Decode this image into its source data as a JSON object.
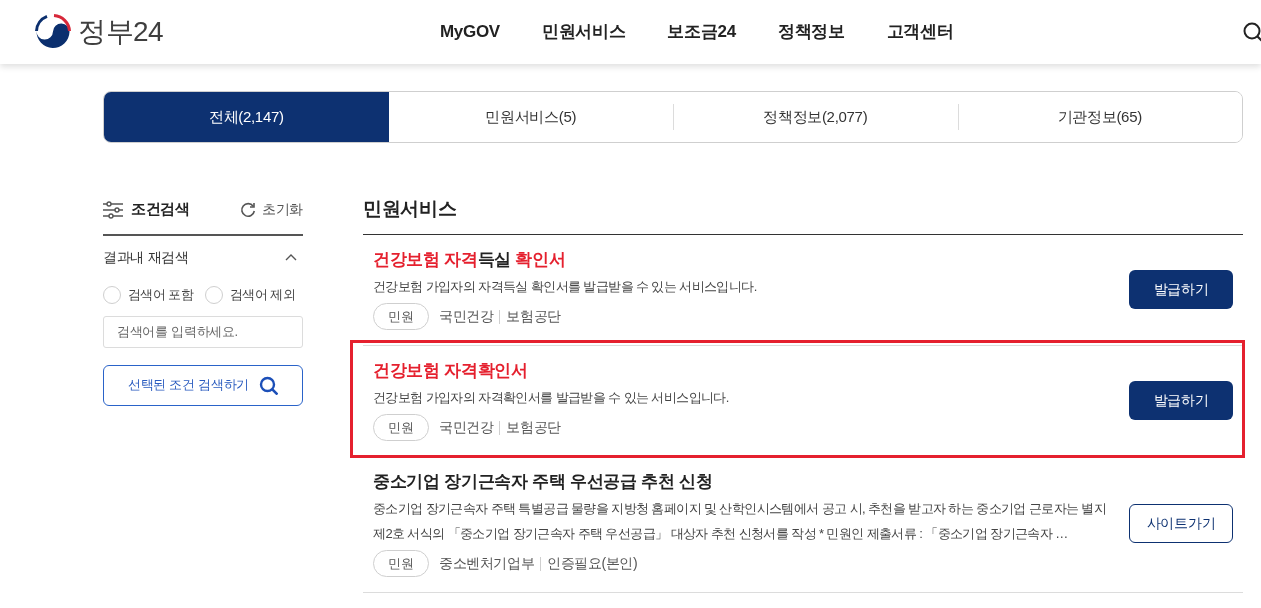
{
  "header": {
    "logo_text": "정부24",
    "nav": [
      "MyGOV",
      "민원서비스",
      "보조금24",
      "정책정보",
      "고객센터"
    ]
  },
  "tabs": [
    {
      "label": "전체(2,147)",
      "selected": true
    },
    {
      "label": "민원서비스(5)",
      "selected": false
    },
    {
      "label": "정책정보(2,077)",
      "selected": false
    },
    {
      "label": "기관정보(65)",
      "selected": false
    }
  ],
  "filter": {
    "title": "조건검색",
    "reset": "초기화",
    "section": {
      "title": "결과내 재검색",
      "expanded": true,
      "options": [
        {
          "label": "검색어 포함",
          "selected": false
        },
        {
          "label": "검색어 제외",
          "selected": false
        }
      ],
      "input": {
        "placeholder": "검색어를 입력하세요."
      },
      "button": "선택된 조건 검색하기"
    }
  },
  "results": {
    "title": "민원서비스",
    "items": [
      {
        "title": [
          {
            "text": "건강보험 자격",
            "match": true
          },
          {
            "text": "득실 ",
            "match": false
          },
          {
            "text": "확인서",
            "match": true
          }
        ],
        "description": "건강보험 가입자의 자격득실 확인서를 발급받을 수 있는 서비스입니다.",
        "category": "민원",
        "orgs": [
          "국민건강",
          "보험공단"
        ],
        "button": {
          "label": "발급하기",
          "kind": "primary"
        },
        "highlighted": false
      },
      {
        "title": [
          {
            "text": "건강보험 자격확인서",
            "match": true
          }
        ],
        "description": "건강보험 가입자의 자격확인서를 발급받을 수 있는 서비스입니다.",
        "category": "민원",
        "orgs": [
          "국민건강",
          "보험공단"
        ],
        "button": {
          "label": "발급하기",
          "kind": "primary"
        },
        "highlighted": true
      },
      {
        "title": [
          {
            "text": "중소기업 장기근속자 주택 우선공급 추천 신청",
            "match": false
          }
        ],
        "description": "중소기업 장기근속자 주택 특별공급 물량을 지방청 홈페이지 및 산학인시스템에서 공고 시, 추천을 받고자 하는 중소기업 근로자는 별지 제2호 서식의 「중소기업 장기근속자 주택 우선공급」 대상자 추천 신청서를 작성 * 민원인 제출서류 : 「중소기업 장기근속자 …",
        "category": "민원",
        "orgs": [
          "중소벤처기업부",
          "인증필요(본인)"
        ],
        "button": {
          "label": "사이트가기",
          "kind": "outline"
        },
        "highlighted": false
      }
    ]
  }
}
